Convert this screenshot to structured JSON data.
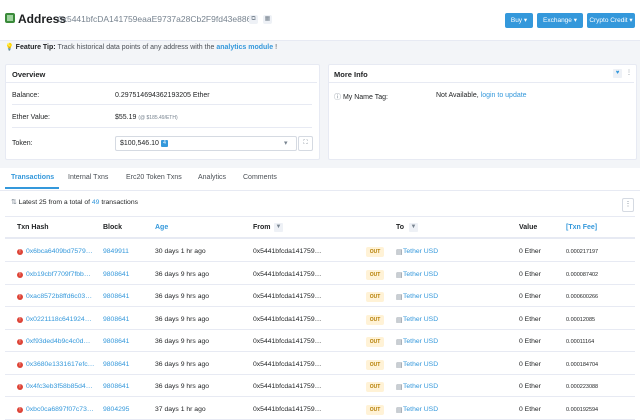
{
  "header": {
    "title": "Address",
    "address": "0x5441bfcDA141759eaaE9737a28Cb2F9fd43e8869",
    "buttons": [
      "Buy",
      "Exchange",
      "Crypto Credit"
    ]
  },
  "tip": {
    "label": "Feature Tip:",
    "text": "Track historical data points of any address with the",
    "link": "analytics module",
    "end": "!"
  },
  "overview": {
    "title": "Overview",
    "balance_label": "Balance:",
    "balance_value": "0.297514694362193205 Ether",
    "ether_value_label": "Ether Value:",
    "ether_value": "$55.19",
    "ether_price": "(@ $185.49/ETH)",
    "token_label": "Token:",
    "token_value": "$100,546.10",
    "token_count": "4"
  },
  "more_info": {
    "title": "More Info",
    "name_tag_label": "My Name Tag:",
    "name_tag_value": "Not Available,",
    "name_tag_link": "login to update"
  },
  "tabs": [
    "Transactions",
    "Internal Txns",
    "Erc20 Token Txns",
    "Analytics",
    "Comments"
  ],
  "summary": {
    "prefix": "Latest 25 from a total of",
    "count": "49",
    "suffix": "transactions"
  },
  "table": {
    "columns": [
      "Txn Hash",
      "Block",
      "Age",
      "From",
      "To",
      "Value",
      "[Txn Fee]"
    ],
    "rows": [
      {
        "hash": "0x6bca6409bd7579…",
        "block": "9849911",
        "age": "30 days 1 hr ago",
        "from": "0x5441bfcda141759…",
        "dir": "OUT",
        "to": "Tether USD",
        "value": "0 Ether",
        "fee": "0.000217197"
      },
      {
        "hash": "0xb19cbf7709f7fbb…",
        "block": "9808641",
        "age": "36 days 9 hrs ago",
        "from": "0x5441bfcda141759…",
        "dir": "OUT",
        "to": "Tether USD",
        "value": "0 Ether",
        "fee": "0.000087402"
      },
      {
        "hash": "0xac8572b8ffd6c03…",
        "block": "9808641",
        "age": "36 days 9 hrs ago",
        "from": "0x5441bfcda141759…",
        "dir": "OUT",
        "to": "Tether USD",
        "value": "0 Ether",
        "fee": "0.000600266"
      },
      {
        "hash": "0x0221118c641924…",
        "block": "9808641",
        "age": "36 days 9 hrs ago",
        "from": "0x5441bfcda141759…",
        "dir": "OUT",
        "to": "Tether USD",
        "value": "0 Ether",
        "fee": "0.00012085"
      },
      {
        "hash": "0xf93ded4b9c4c0d…",
        "block": "9808641",
        "age": "36 days 9 hrs ago",
        "from": "0x5441bfcda141759…",
        "dir": "OUT",
        "to": "Tether USD",
        "value": "0 Ether",
        "fee": "0.00011164"
      },
      {
        "hash": "0x3680e1331617efc…",
        "block": "9808641",
        "age": "36 days 9 hrs ago",
        "from": "0x5441bfcda141759…",
        "dir": "OUT",
        "to": "Tether USD",
        "value": "0 Ether",
        "fee": "0.000184704"
      },
      {
        "hash": "0x4fc3eb3f58b85d4…",
        "block": "9808641",
        "age": "36 days 9 hrs ago",
        "from": "0x5441bfcda141759…",
        "dir": "OUT",
        "to": "Tether USD",
        "value": "0 Ether",
        "fee": "0.000223088"
      },
      {
        "hash": "0xbc0ca6897f07c73…",
        "block": "9804295",
        "age": "37 days 1 hr ago",
        "from": "0x5441bfcda141759…",
        "dir": "OUT",
        "to": "Tether USD",
        "value": "0 Ether",
        "fee": "0.000192594"
      }
    ]
  },
  "colors": {
    "accent": "#3498db",
    "error": "#de4437",
    "out_badge": "#fff2d6"
  }
}
